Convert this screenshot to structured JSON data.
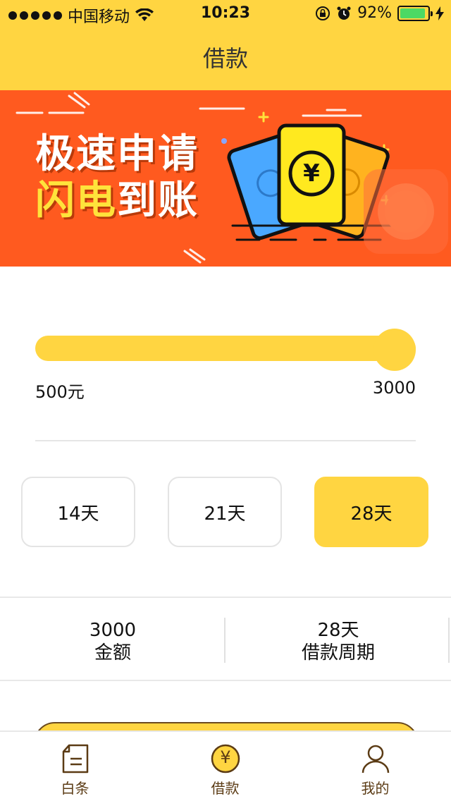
{
  "status_bar": {
    "carrier": "中国移动",
    "time": "10:23",
    "battery": "92%",
    "battery_level": 0.92
  },
  "nav": {
    "title": "借款"
  },
  "banner": {
    "line1": "极速申请",
    "line2_highlight": "闪电",
    "line2_rest": "到账",
    "ticket_symbol": "¥"
  },
  "slider": {
    "min_label": "500元",
    "max_label": "3000",
    "value_fraction": 1.0
  },
  "periods": [
    {
      "label": "14天",
      "selected": false
    },
    {
      "label": "21天",
      "selected": false
    },
    {
      "label": "28天",
      "selected": true
    }
  ],
  "summary": {
    "amount_value": "3000",
    "amount_label": "金额",
    "period_value": "28天",
    "period_label": "借款周期"
  },
  "tabs": [
    {
      "label": "白条",
      "icon": "document-icon"
    },
    {
      "label": "借款",
      "icon": "yuan-coin-icon"
    },
    {
      "label": "我的",
      "icon": "user-icon"
    }
  ],
  "colors": {
    "primary": "#ffd541",
    "banner": "#ff5a1f",
    "tab_text": "#5b3b14"
  }
}
